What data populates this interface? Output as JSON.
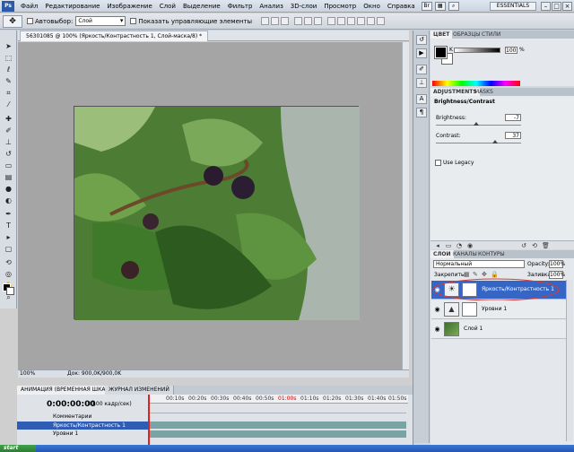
{
  "menubar": {
    "logo": "Ps",
    "items": [
      "Файл",
      "Редактирование",
      "Изображение",
      "Слой",
      "Выделение",
      "Фильтр",
      "Анализ",
      "3D-слои",
      "Просмотр",
      "Окно",
      "Справка"
    ],
    "workspace": "ESSENTIALS"
  },
  "optbar": {
    "autoselect_label": "Автовыбор:",
    "autoselect_value": "Слой",
    "show_controls_label": "Показать управляющие элементы"
  },
  "document": {
    "tab_title": "56301085 @ 100% (Яркость/Контрастность 1, Слой-маска/8) *",
    "zoom": "100%",
    "doc_info": "Док: 900,0K/900,0K"
  },
  "color_panel": {
    "tabs": [
      "ЦВЕТ",
      "ОБРАЗЦЫ",
      "СТИЛИ"
    ],
    "k_label": "K",
    "k_value": "100",
    "k_unit": "%"
  },
  "adjustments": {
    "tabs": [
      "ADJUSTMENTS",
      "MASKS"
    ],
    "title": "Brightness/Contrast",
    "brightness_label": "Brightness:",
    "brightness_value": "-7",
    "contrast_label": "Contrast:",
    "contrast_value": "37",
    "legacy_label": "Use Legacy"
  },
  "layers": {
    "tabs": [
      "СЛОИ",
      "КАНАЛЫ",
      "КОНТУРЫ"
    ],
    "blend_mode": "Нормальный",
    "opacity_label": "Opacity:",
    "opacity_value": "100%",
    "lock_label": "Закрепить:",
    "fill_label": "Заливка:",
    "fill_value": "100%",
    "rows": [
      {
        "name": "Яркость/Контрастность 1",
        "selected": true
      },
      {
        "name": "Уровни 1",
        "selected": false
      },
      {
        "name": "Слой 1",
        "selected": false
      }
    ]
  },
  "animation": {
    "tabs": [
      "АНИМАЦИЯ (ВРЕМЕННАЯ ШКАЛА)",
      "ЖУРНАЛ ИЗМЕНЕНИЙ"
    ],
    "timecode": "0:00:00:00",
    "fps": "(30,00 кадр/сек)",
    "ticks": [
      "00:10s",
      "00:20s",
      "00:30s",
      "00:40s",
      "00:50s",
      "01:00s",
      "01:10s",
      "01:20s",
      "01:30s",
      "01:40s",
      "01:50s"
    ],
    "rows": [
      "Комментарии",
      "Яркость/Контрастность 1",
      "Уровни 1"
    ]
  }
}
